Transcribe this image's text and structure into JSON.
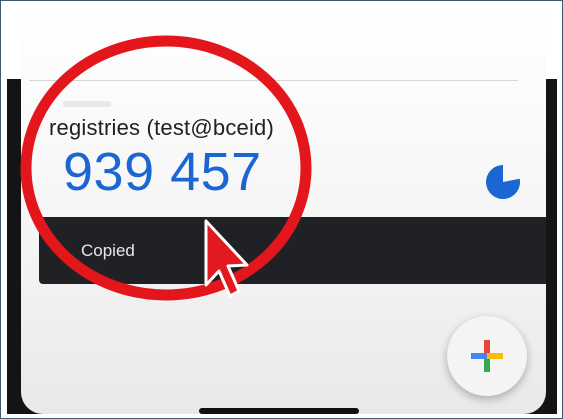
{
  "entry": {
    "account": "registries (test@bceid)",
    "code": "939 457",
    "timer_remaining": 0.78
  },
  "snackbar": {
    "message": "Copied"
  },
  "colors": {
    "code": "#1a66d2",
    "timer": "#1a66d2",
    "snackbar_bg": "#202124",
    "annotation": "#e3161c"
  },
  "icons": {
    "timer": "countdown-pie-icon",
    "add": "multicolor-plus-icon",
    "cursor": "mouse-pointer-icon"
  }
}
